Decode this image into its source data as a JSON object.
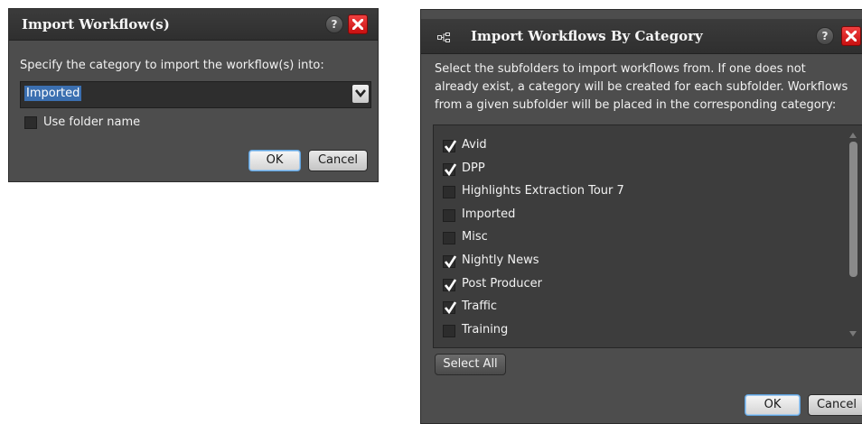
{
  "dialog1": {
    "title": "Import Workflow(s)",
    "help_label": "?",
    "prompt": "Specify the category to import the workflow(s) into:",
    "category_select": {
      "value": "Imported"
    },
    "use_folder_name": {
      "label": "Use folder name",
      "checked": false
    },
    "ok_label": "OK",
    "cancel_label": "Cancel"
  },
  "dialog2": {
    "title": "Import Workflows By Category",
    "help_label": "?",
    "description_lines": [
      "Select the subfolders to import workflows from. If one does not",
      "already exist, a category will be created for each subfolder. Workflows",
      "from a given subfolder will be placed in the corresponding category:"
    ],
    "subfolders": [
      {
        "label": "Avid",
        "checked": true
      },
      {
        "label": "DPP",
        "checked": true
      },
      {
        "label": "Highlights Extraction Tour 7",
        "checked": false
      },
      {
        "label": "Imported",
        "checked": false
      },
      {
        "label": "Misc",
        "checked": false
      },
      {
        "label": "Nightly News",
        "checked": true
      },
      {
        "label": "Post Producer",
        "checked": true
      },
      {
        "label": "Traffic",
        "checked": true
      },
      {
        "label": "Training",
        "checked": false
      }
    ],
    "select_all_label": "Select All",
    "ok_label": "OK",
    "cancel_label": "Cancel"
  },
  "colors": {
    "dialog_bg": "#4d4d4d",
    "titlebar_bg": "#333333",
    "close_red": "#e02020",
    "selection_blue": "#3b6fb0",
    "focus_blue": "#5fa2dd"
  }
}
